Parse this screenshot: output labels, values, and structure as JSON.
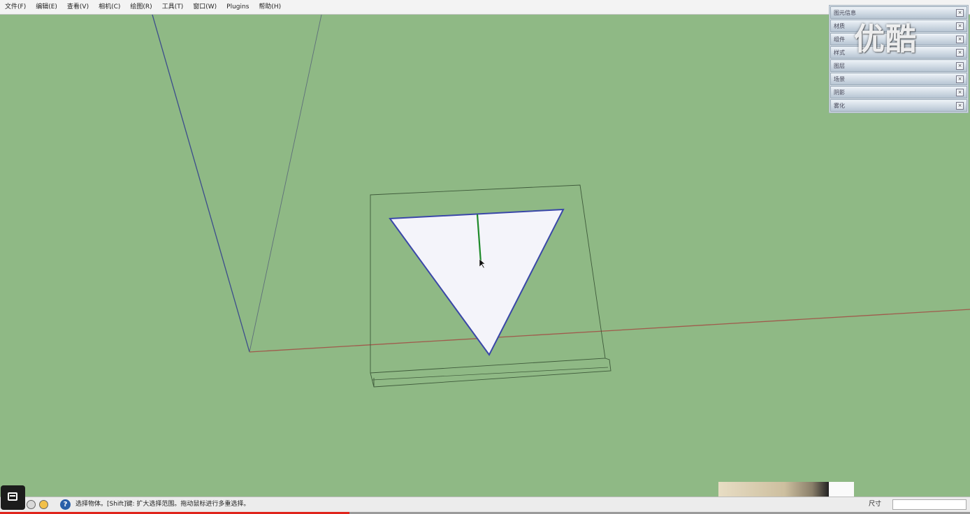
{
  "menubar": {
    "items": [
      {
        "name": "menu-file",
        "label": "文件(F)"
      },
      {
        "name": "menu-edit",
        "label": "编辑(E)"
      },
      {
        "name": "menu-view",
        "label": "查看(V)"
      },
      {
        "name": "menu-camera",
        "label": "相机(C)"
      },
      {
        "name": "menu-draw",
        "label": "绘图(R)"
      },
      {
        "name": "menu-tools",
        "label": "工具(T)"
      },
      {
        "name": "menu-window",
        "label": "窗口(W)"
      },
      {
        "name": "menu-plugins",
        "label": "Plugins"
      },
      {
        "name": "menu-help",
        "label": "帮助(H)"
      }
    ]
  },
  "tray": {
    "panels": [
      {
        "label": "图元信息",
        "close": "×"
      },
      {
        "label": "材质",
        "close": "×"
      },
      {
        "label": "组件",
        "close": "×"
      },
      {
        "label": "样式",
        "close": "×"
      },
      {
        "label": "图层",
        "close": "×"
      },
      {
        "label": "场景",
        "close": "×"
      },
      {
        "label": "阴影",
        "close": "×"
      },
      {
        "label": "雾化",
        "close": "×"
      }
    ]
  },
  "watermark": {
    "text": "优酷"
  },
  "statusbar": {
    "hint": "选择物体。[Shift]键: 扩大选择范围。拖动鼠标进行多重选择。",
    "help_glyph": "?",
    "measure_label": "尺寸",
    "measure_value": ""
  },
  "viewport": {
    "background": "#8fb985",
    "face_fill": "#f4f4fa",
    "face_edge": "#3a47a8",
    "green_axis": "#1e8a2a",
    "red_axis": "#a05a4c",
    "blue_axis": "#3c4c8c"
  },
  "player": {
    "played_fraction": 0.36
  }
}
